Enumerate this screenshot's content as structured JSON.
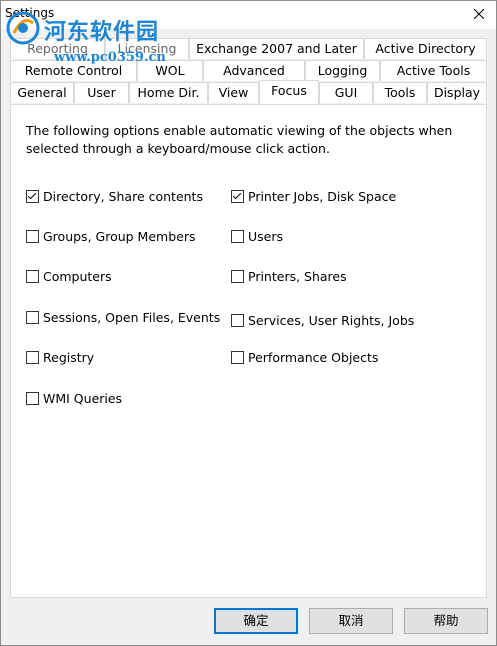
{
  "window": {
    "title": "Settings"
  },
  "watermark": {
    "line1": "河东软件园",
    "line2": "www.pc0359.cn"
  },
  "tabs": {
    "row1": [
      "Reporting",
      "Licensing",
      "Exchange 2007 and Later",
      "Active Directory"
    ],
    "row2": [
      "Remote Control",
      "WOL",
      "Advanced",
      "Logging",
      "Active Tools"
    ],
    "row3": [
      "General",
      "User",
      "Home Dir.",
      "View",
      "Focus",
      "GUI",
      "Tools",
      "Display"
    ],
    "active": "Focus"
  },
  "focus": {
    "description": "The following options enable automatic viewing of the objects when selected through a keyboard/mouse click action.",
    "options": [
      {
        "label": "Directory, Share contents",
        "checked": true
      },
      {
        "label": "Printer Jobs, Disk Space",
        "checked": true
      },
      {
        "label": "Groups, Group Members",
        "checked": false
      },
      {
        "label": "Users",
        "checked": false
      },
      {
        "label": "Computers",
        "checked": false
      },
      {
        "label": "Printers, Shares",
        "checked": false
      },
      {
        "label": "Sessions, Open Files, Events",
        "checked": false
      },
      {
        "label": "Services, User Rights, Jobs",
        "checked": false
      },
      {
        "label": "Registry",
        "checked": false
      },
      {
        "label": "Performance Objects",
        "checked": false
      },
      {
        "label": "WMI Queries",
        "checked": false
      }
    ]
  },
  "buttons": {
    "ok": "确定",
    "cancel": "取消",
    "help": "帮助"
  }
}
